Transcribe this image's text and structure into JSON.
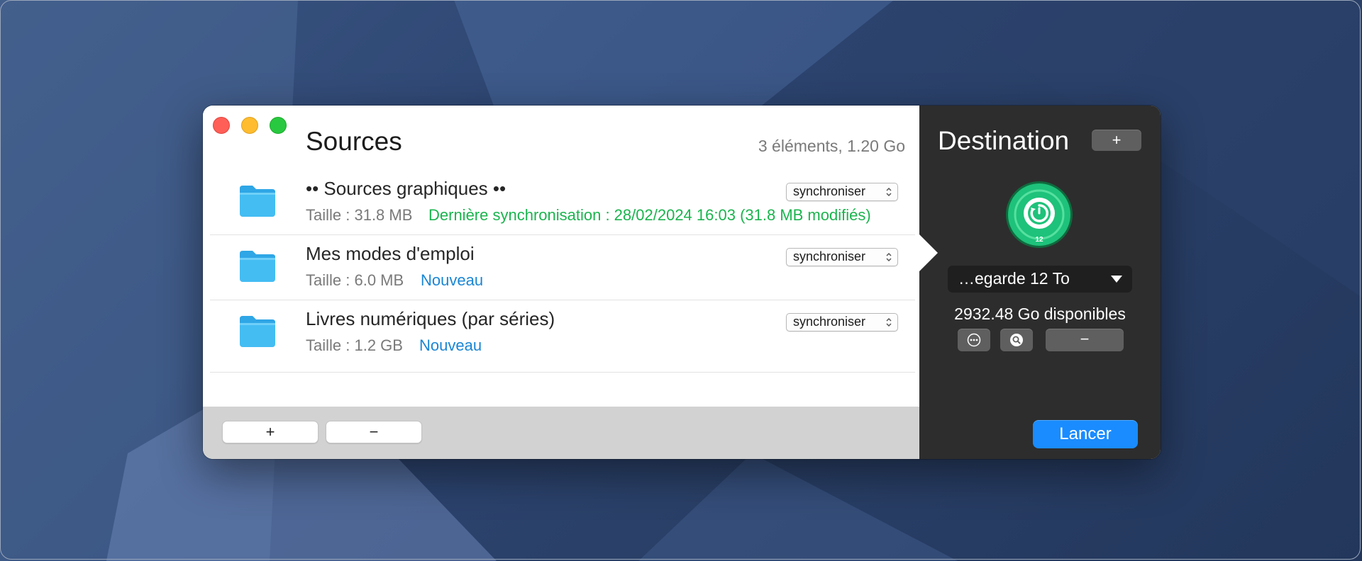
{
  "sources": {
    "title": "Sources",
    "summary": "3 éléments, 1.20 Go",
    "items": [
      {
        "name": "•• Sources graphiques ••",
        "size": "Taille : 31.8 MB",
        "status": "Dernière synchronisation : 28/02/2024 16:03 (31.8 MB modifiés)",
        "status_type": "synced",
        "mode": "synchroniser",
        "icon": "folder-icon"
      },
      {
        "name": "Mes modes d'emploi",
        "size": "Taille : 6.0 MB",
        "status": "Nouveau",
        "status_type": "new",
        "mode": "synchroniser",
        "icon": "folder-icon"
      },
      {
        "name": "Livres numériques (par séries)",
        "size": "Taille : 1.2 GB",
        "status": "Nouveau",
        "status_type": "new",
        "mode": "synchroniser",
        "icon": "folder-icon"
      }
    ]
  },
  "destination": {
    "title": "Destination",
    "add_label": "+",
    "disk_badge": "12",
    "disk_name": "…egarde 12 To",
    "available": "2932.48 Go disponibles",
    "remove_label": "−",
    "icons": [
      "more-icon",
      "reveal-icon",
      "backup-disk-icon"
    ]
  },
  "bottom": {
    "add_label": "+",
    "remove_label": "−",
    "launch_label": "Lancer"
  },
  "colors": {
    "status_green": "#1bb44e",
    "status_blue": "#1a86d4",
    "accent": "#1a8cff",
    "destination_bg": "#2d2d2d",
    "disk_green": "#1ec27a"
  }
}
